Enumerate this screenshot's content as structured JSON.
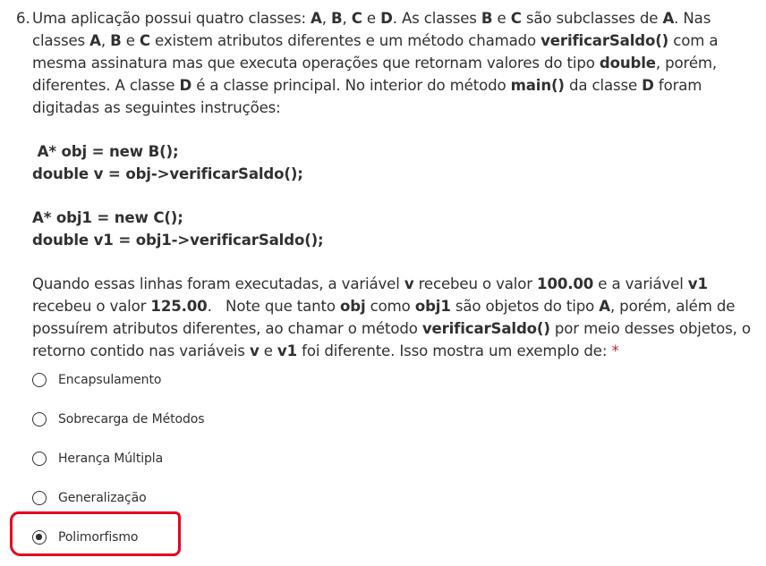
{
  "question": {
    "number": "6.",
    "p1_parts": [
      "Uma aplicação possui quatro classes: ",
      "A",
      ", ",
      "B",
      ", ",
      "C",
      " e ",
      "D",
      ". As classes ",
      "B",
      " e ",
      "C",
      " são subclasses de ",
      "A",
      ". Nas classes ",
      "A",
      ", ",
      "B",
      " e ",
      "C",
      " existem atributos diferentes e um método chamado ",
      "verificarSaldo()",
      " com a mesma assinatura mas que executa operações que retornam valores do tipo ",
      "double",
      ", porém, diferentes. A classe ",
      "D",
      " é a classe principal. No interior do método ",
      "main()",
      " da classe ",
      "D",
      " foram digitadas as seguintes instruções:"
    ],
    "code": [
      " A* obj = new B();",
      "double v = obj->verificarSaldo();",
      "A* obj1 = new C();",
      "double v1 = obj1->verificarSaldo();"
    ],
    "p2_parts": [
      "Quando essas linhas foram executadas, a variável ",
      "v",
      " recebeu o valor ",
      "100.00",
      " e a variável ",
      "v1",
      " recebeu o valor ",
      "125.00",
      ".   Note que tanto ",
      "obj",
      " como ",
      "obj1",
      " são objetos do tipo ",
      "A",
      ", porém, além de possuírem atributos diferentes, ao chamar o método ",
      "verificarSaldo()",
      " por meio desses objetos, o retorno contido nas variáveis ",
      "v",
      " e ",
      "v1",
      " foi diferente. Isso mostra um exemplo de: "
    ],
    "required_mark": "*"
  },
  "options": [
    {
      "label": "Encapsulamento",
      "selected": false
    },
    {
      "label": "Sobrecarga de Métodos",
      "selected": false
    },
    {
      "label": "Herança Múltipla",
      "selected": false
    },
    {
      "label": "Generalização",
      "selected": false
    },
    {
      "label": "Polimorfismo",
      "selected": true
    }
  ],
  "colors": {
    "text": "#323130",
    "required": "#c4262e",
    "highlight": "#e8001c"
  }
}
